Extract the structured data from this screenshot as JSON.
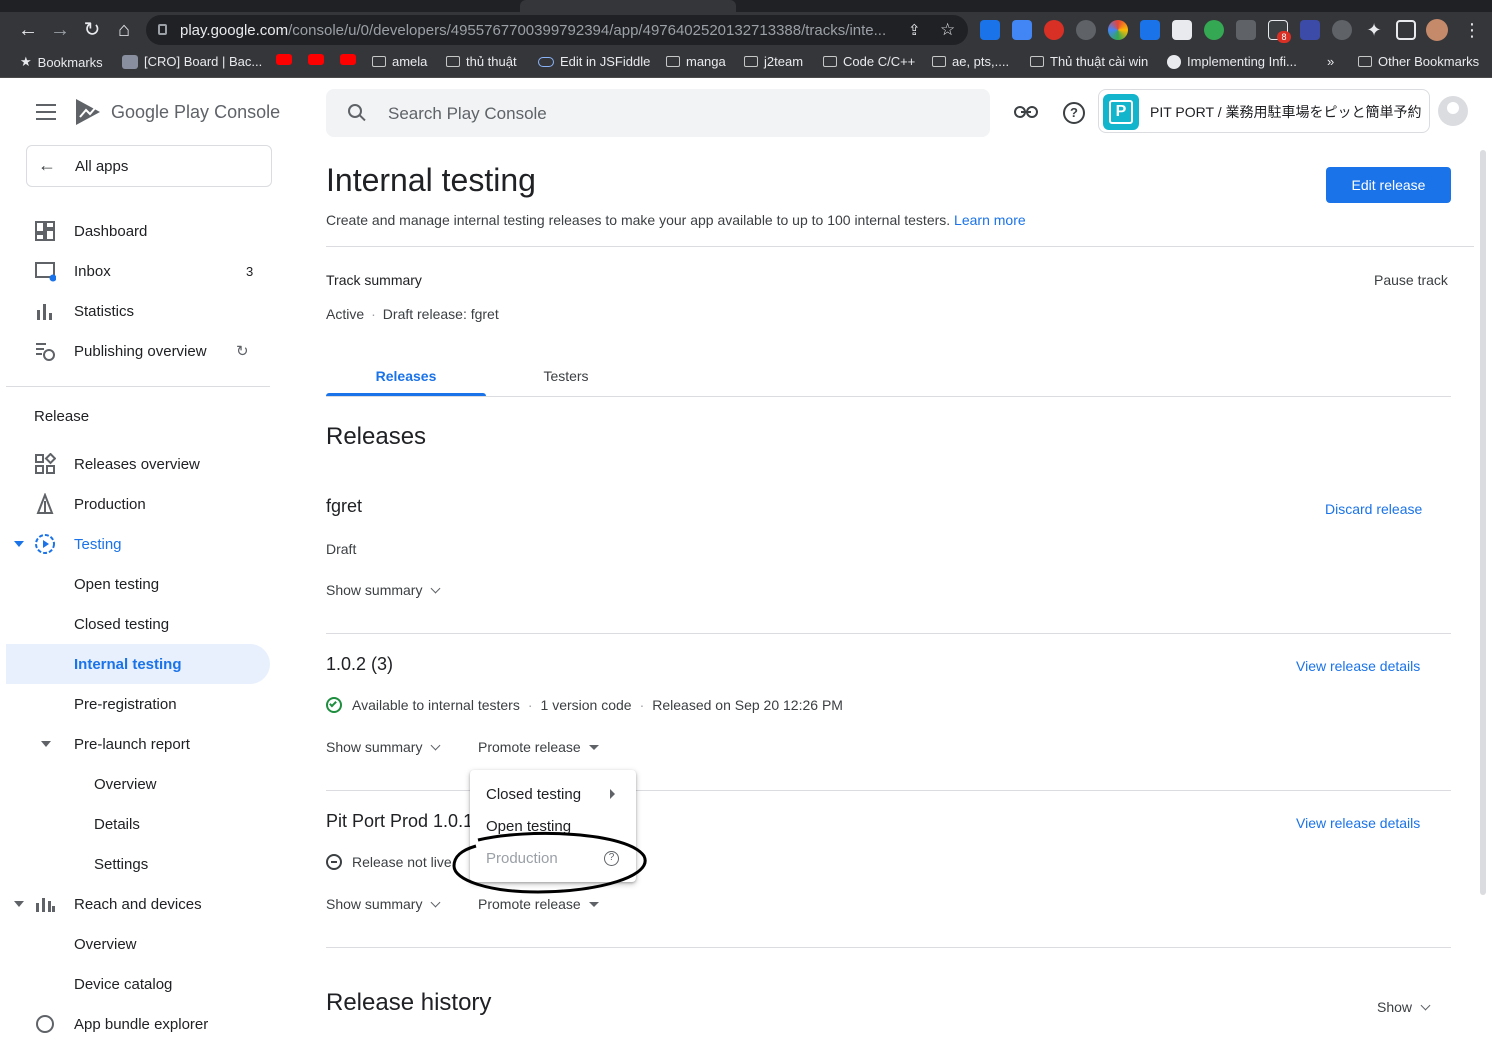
{
  "browser": {
    "url_host": "play.google.com",
    "url_path": "/console/u/0/developers/4955767700399792394/app/4976402520132713388/tracks/inte...",
    "bookmarks": [
      {
        "label": "Bookmarks",
        "icon": "star-icon"
      },
      {
        "label": "[CRO] Board | Bac...",
        "icon": "app-icon"
      },
      {
        "label": "",
        "icon": "youtube-icon"
      },
      {
        "label": "",
        "icon": "youtube-icon"
      },
      {
        "label": "",
        "icon": "youtube-icon"
      },
      {
        "label": "amela",
        "icon": "folder-icon"
      },
      {
        "label": "thủ thuật",
        "icon": "folder-icon"
      },
      {
        "label": "Edit in JSFiddle",
        "icon": "cloud-icon"
      },
      {
        "label": "manga",
        "icon": "folder-icon"
      },
      {
        "label": "j2team",
        "icon": "folder-icon"
      },
      {
        "label": "Code C/C++",
        "icon": "folder-icon"
      },
      {
        "label": "ae, pts,....",
        "icon": "folder-icon"
      },
      {
        "label": "Thủ thuật cài win",
        "icon": "folder-icon"
      },
      {
        "label": "Implementing Infi...",
        "icon": "globe-icon"
      }
    ],
    "more_bookmarks": "»",
    "other_bookmarks": "Other Bookmarks",
    "ext_badge": "8"
  },
  "console": {
    "brand_google": "Google Play",
    "brand_console": "Console",
    "all_apps": "All apps",
    "search_placeholder": "Search Play Console",
    "app_name": "PIT PORT / 業務用駐車場をピッと簡単予約",
    "app_icon_letter": "P"
  },
  "sidebar": {
    "dashboard": "Dashboard",
    "inbox": "Inbox",
    "inbox_count": "3",
    "statistics": "Statistics",
    "publishing_overview": "Publishing overview",
    "release_header": "Release",
    "releases_overview": "Releases overview",
    "production": "Production",
    "testing": "Testing",
    "open_testing": "Open testing",
    "closed_testing": "Closed testing",
    "internal_testing": "Internal testing",
    "pre_registration": "Pre-registration",
    "pre_launch_report": "Pre-launch report",
    "overview": "Overview",
    "details": "Details",
    "settings": "Settings",
    "reach_and_devices": "Reach and devices",
    "reach_overview": "Overview",
    "device_catalog": "Device catalog",
    "app_bundle_explorer": "App bundle explorer"
  },
  "page": {
    "title": "Internal testing",
    "description": "Create and manage internal testing releases to make your app available to up to 100 internal testers.",
    "learn_more": "Learn more",
    "edit_release": "Edit release",
    "track_summary": "Track summary",
    "pause_track": "Pause track",
    "status_active": "Active",
    "draft_release": "Draft release: fgret",
    "tabs": [
      "Releases",
      "Testers"
    ],
    "releases_heading": "Releases",
    "release_history": "Release history",
    "show": "Show"
  },
  "releases": [
    {
      "name": "fgret",
      "status": "Draft",
      "action": "Discard release",
      "show_summary": "Show summary"
    },
    {
      "name": "1.0.2 (3)",
      "status": "Available to internal testers",
      "version_codes": "1 version code",
      "released_on": "Released on Sep 20 12:26 PM",
      "action": "View release details",
      "show_summary": "Show summary",
      "promote": "Promote release"
    },
    {
      "name": "Pit Port Prod 1.0.1",
      "status": "Release not live",
      "action": "View release details",
      "show_summary": "Show summary",
      "promote": "Promote release"
    }
  ],
  "promote_menu": {
    "items": [
      "Closed testing",
      "Open testing",
      "Production"
    ]
  },
  "colors": {
    "accent": "#1a73e8",
    "edit_button": "#1a73e8",
    "success": "#1e8e3e",
    "app_icon": "#12b5cb"
  }
}
